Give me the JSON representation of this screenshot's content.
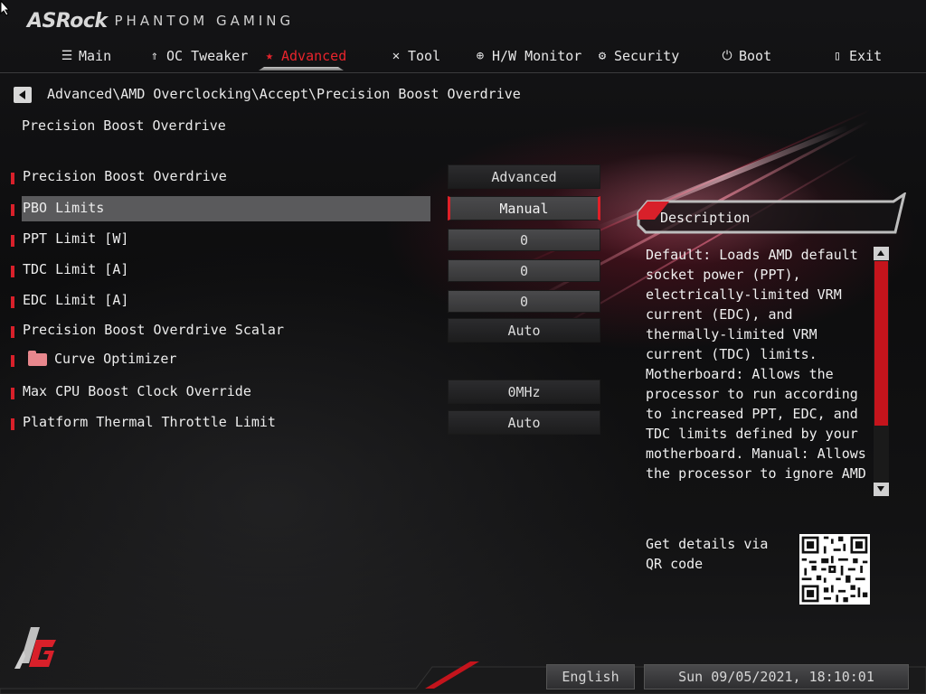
{
  "header": {
    "brand": "ASRock",
    "sub_brand": "PHANTOM GAMING"
  },
  "tabs": [
    {
      "label": "Main",
      "icon": "list-icon",
      "active": false
    },
    {
      "label": "OC Tweaker",
      "icon": "rocket-icon",
      "active": false
    },
    {
      "label": "Advanced",
      "icon": "star-icon",
      "active": true
    },
    {
      "label": "Tool",
      "icon": "tools-icon",
      "active": false
    },
    {
      "label": "H/W Monitor",
      "icon": "crosshair-icon",
      "active": false
    },
    {
      "label": "Security",
      "icon": "shield-icon",
      "active": false
    },
    {
      "label": "Boot",
      "icon": "power-icon",
      "active": false
    },
    {
      "label": "Exit",
      "icon": "exit-door-icon",
      "active": false
    }
  ],
  "breadcrumb": "Advanced\\AMD Overclocking\\Accept\\Precision Boost Overdrive",
  "page_title": "Precision Boost Overdrive",
  "settings": [
    {
      "label": "Precision Boost Overdrive",
      "value": "Advanced",
      "kind": "select"
    },
    {
      "label": "PBO Limits",
      "value": "Manual",
      "kind": "select",
      "selected": true
    },
    {
      "label": "PPT Limit [W]",
      "value": "0",
      "kind": "input"
    },
    {
      "label": "TDC Limit [A]",
      "value": "0",
      "kind": "input"
    },
    {
      "label": "EDC Limit [A]",
      "value": "0",
      "kind": "input"
    },
    {
      "label": "Precision Boost Overdrive Scalar",
      "value": "Auto",
      "kind": "select"
    },
    {
      "label": "Curve Optimizer",
      "value": "",
      "kind": "submenu",
      "icon": "folder-icon"
    },
    {
      "label": "Max CPU Boost Clock Override",
      "value": "0MHz",
      "kind": "select"
    },
    {
      "label": "Platform Thermal Throttle Limit",
      "value": "Auto",
      "kind": "select"
    }
  ],
  "description": {
    "title": "Description",
    "text": "Default: Loads AMD default socket power (PPT), electrically-limited VRM current (EDC), and thermally-limited VRM current (TDC) limits. Motherboard: Allows the processor to run according to increased PPT, EDC, and TDC limits defined by your motherboard. Manual: Allows the processor to ignore AMD default limits for PPT,"
  },
  "qr": {
    "text": "Get details via QR code"
  },
  "footer": {
    "language": "English",
    "datetime": "Sun 09/05/2021, 18:10:01"
  },
  "colors": {
    "accent": "#e02028",
    "background": "#0b0b0c",
    "text": "#e8e8e8"
  }
}
